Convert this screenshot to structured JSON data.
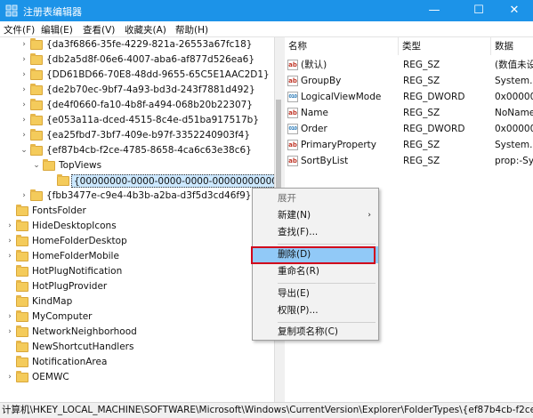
{
  "window": {
    "title": "注册表编辑器",
    "min_glyph": "—",
    "max_glyph": "☐",
    "close_glyph": "✕"
  },
  "menu": [
    "文件(F)",
    "编辑(E)",
    "查看(V)",
    "收藏夹(A)",
    "帮助(H)"
  ],
  "tree": {
    "items": [
      {
        "label": "{da3f6866-35fe-4229-821a-26553a67fc18}",
        "exp": "›"
      },
      {
        "label": "{db2a5d8f-06e6-4007-aba6-af877d526ea6}",
        "exp": "›"
      },
      {
        "label": "{DD61BD66-70E8-48dd-9655-65C5E1AAC2D1}",
        "exp": "›"
      },
      {
        "label": "{de2b70ec-9bf7-4a93-bd3d-243f7881d492}",
        "exp": "›"
      },
      {
        "label": "{de4f0660-fa10-4b8f-a494-068b20b22307}",
        "exp": "›"
      },
      {
        "label": "{e053a11a-dced-4515-8c4e-d51ba917517b}",
        "exp": "›"
      },
      {
        "label": "{ea25fbd7-3bf7-409e-b97f-3352240903f4}",
        "exp": "›"
      },
      {
        "label": "{ef87b4cb-f2ce-4785-8658-4ca6c63e38c6}",
        "exp": "⌄"
      },
      {
        "label": "TopViews",
        "exp": "⌄"
      },
      {
        "label": "{00000000-0000-0000-0000-000000000000}",
        "exp": ""
      },
      {
        "label": "{fbb3477e-c9e4-4b3b-a2ba-d3f5d3cd46f9}",
        "exp": "›"
      },
      {
        "label": "FontsFolder",
        "exp": ""
      },
      {
        "label": "HideDesktopIcons",
        "exp": "›"
      },
      {
        "label": "HomeFolderDesktop",
        "exp": "›"
      },
      {
        "label": "HomeFolderMobile",
        "exp": "›"
      },
      {
        "label": "HotPlugNotification",
        "exp": ""
      },
      {
        "label": "HotPlugProvider",
        "exp": ""
      },
      {
        "label": "KindMap",
        "exp": ""
      },
      {
        "label": "MyComputer",
        "exp": "›"
      },
      {
        "label": "NetworkNeighborhood",
        "exp": "›"
      },
      {
        "label": "NewShortcutHandlers",
        "exp": ""
      },
      {
        "label": "NotificationArea",
        "exp": ""
      },
      {
        "label": "OEMWC",
        "exp": "›"
      }
    ]
  },
  "list": {
    "headers": [
      "名称",
      "类型",
      "数据"
    ],
    "rows": [
      {
        "icon": "ab",
        "name": "(默认)",
        "type": "REG_SZ",
        "data": "(数值未设"
      },
      {
        "icon": "ab",
        "name": "GroupBy",
        "type": "REG_SZ",
        "data": "System.S"
      },
      {
        "icon": "010",
        "name": "LogicalViewMode",
        "type": "REG_DWORD",
        "data": "0x000000"
      },
      {
        "icon": "ab",
        "name": "Name",
        "type": "REG_SZ",
        "data": "NoName"
      },
      {
        "icon": "010",
        "name": "Order",
        "type": "REG_DWORD",
        "data": "0x000000"
      },
      {
        "icon": "ab",
        "name": "PrimaryProperty",
        "type": "REG_SZ",
        "data": "System.S"
      },
      {
        "icon": "ab",
        "name": "SortByList",
        "type": "REG_SZ",
        "data": "prop:-Sy"
      }
    ]
  },
  "context_menu": {
    "expand": "展开",
    "new": "新建(N)",
    "find": "查找(F)...",
    "delete": "删除(D)",
    "rename": "重命名(R)",
    "export": "导出(E)",
    "permissions": "权限(P)...",
    "copy_key_name": "复制项名称(C)",
    "submenu_arrow": "›"
  },
  "status": "计算机\\HKEY_LOCAL_MACHINE\\SOFTWARE\\Microsoft\\Windows\\CurrentVersion\\Explorer\\FolderTypes\\{ef87b4cb-f2ce-"
}
